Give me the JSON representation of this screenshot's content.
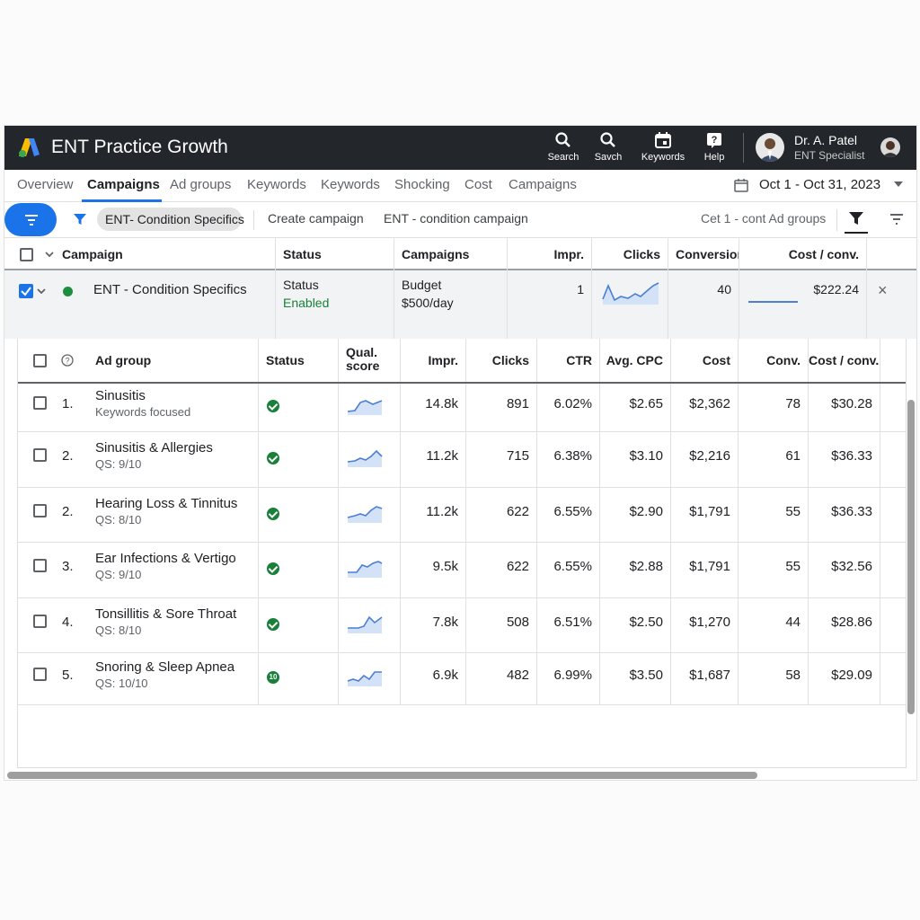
{
  "header": {
    "title": "ENT Practice Growth",
    "buttons": [
      {
        "label": "Search",
        "icon": "search-icon"
      },
      {
        "label": "Savch",
        "icon": "search-icon"
      },
      {
        "label": "Keywords",
        "icon": "calendar-icon"
      },
      {
        "label": "Help",
        "icon": "help-icon"
      }
    ],
    "user": {
      "name": "Dr. A. Patel",
      "role": "ENT Specialist"
    }
  },
  "tabs": [
    "Overview",
    "Campaigns",
    "Ad groups",
    "Keywords",
    "Keywords",
    "Shocking",
    "Cost",
    "Campaigns"
  ],
  "active_tab": "Campaigns",
  "date_range": "Oct 1 - Oct 31, 2023",
  "filterbar": {
    "chip": "ENT- Condition Specifics",
    "create": "Create campaign",
    "campaign_text": "ENT - condition campaign",
    "right_text": "Cet 1 - cont Ad groups"
  },
  "campaign_table": {
    "headers": [
      "Campaign",
      "Status",
      "Campaigns",
      "Impr.",
      "Clicks",
      "Conversior",
      "Cost / conv."
    ],
    "row": {
      "name": "ENT - Condition Specifics",
      "status_label": "Status",
      "status_value": "Enabled",
      "budget_label": "Budget",
      "budget_value": "$500/day",
      "impr": "1",
      "conversions": "40",
      "cost_conv": "$222.24",
      "close": "×"
    }
  },
  "adgroup_table": {
    "headers": {
      "ad_group": "Ad group",
      "status": "Status",
      "qual_1": "Qual.",
      "qual_2": "score",
      "impr": "Impr.",
      "clicks": "Clicks",
      "ctr": "CTR",
      "avg_cpc": "Avg. CPC",
      "cost": "Cost",
      "conv": "Conv.",
      "cost_conv": "Cost / conv."
    },
    "rows": [
      {
        "idx": "1.",
        "name": "Sinusitis",
        "sub": "Keywords focused",
        "status": "ok",
        "impr": "14.8k",
        "clicks": "891",
        "ctr": "6.02%",
        "cpc": "$2.65",
        "cost": "$2,362",
        "conv": "78",
        "cost_conv": "$30.28"
      },
      {
        "idx": "2.",
        "name": "Sinusitis & Allergies",
        "sub": "QS: 9/10",
        "status": "ok",
        "impr": "11.2k",
        "clicks": "715",
        "ctr": "6.38%",
        "cpc": "$3.10",
        "cost": "$2,216",
        "conv": "61",
        "cost_conv": "$36.33"
      },
      {
        "idx": "2.",
        "name": "Hearing Loss & Tinnitus",
        "sub": "QS: 8/10",
        "status": "ok",
        "impr": "11.2k",
        "clicks": "622",
        "ctr": "6.55%",
        "cpc": "$2.90",
        "cost": "$1,791",
        "conv": "55",
        "cost_conv": "$36.33"
      },
      {
        "idx": "3.",
        "name": "Ear Infections & Vertigo",
        "sub": "QS: 9/10",
        "status": "ok",
        "impr": "9.5k",
        "clicks": "622",
        "ctr": "6.55%",
        "cpc": "$2.88",
        "cost": "$1,791",
        "conv": "55",
        "cost_conv": "$32.56"
      },
      {
        "idx": "4.",
        "name": "Tonsillitis & Sore Throat",
        "sub": "QS: 8/10",
        "status": "ok",
        "impr": "7.8k",
        "clicks": "508",
        "ctr": "6.51%",
        "cpc": "$2.50",
        "cost": "$1,270",
        "conv": "44",
        "cost_conv": "$28.86"
      },
      {
        "idx": "5.",
        "name": "Snoring & Sleep Apnea",
        "sub": "QS: 10/10",
        "status": "num",
        "status_text": "10",
        "impr": "6.9k",
        "clicks": "482",
        "ctr": "6.99%",
        "cpc": "$3.50",
        "cost": "$1,687",
        "conv": "58",
        "cost_conv": "$29.09"
      }
    ]
  },
  "colors": {
    "topbar": "#23262b",
    "accent": "#1a73e8",
    "status_green": "#188038",
    "sparkline": "#4a7fd4"
  }
}
